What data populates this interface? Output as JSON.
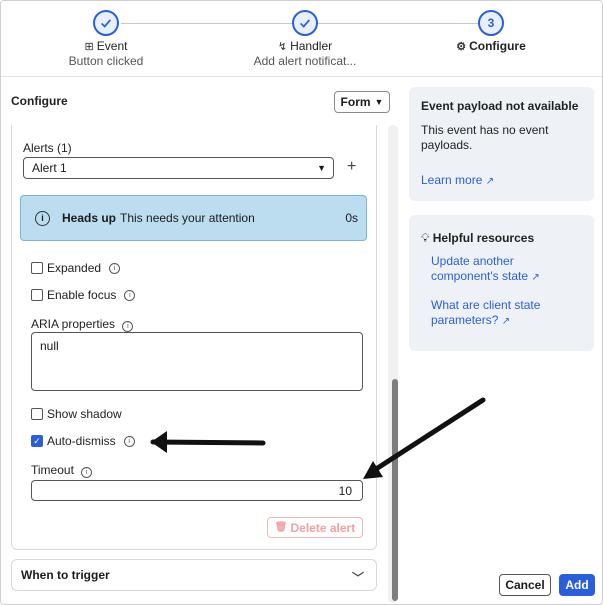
{
  "stepper": {
    "steps": [
      {
        "title": "Event",
        "subtitle": "Button clicked",
        "state": "completed"
      },
      {
        "title": "Handler",
        "subtitle": "Add alert notificat...",
        "state": "completed"
      },
      {
        "title": "Configure",
        "number": "3",
        "state": "current"
      }
    ]
  },
  "left_panel": {
    "title": "Configure",
    "form_button": "Form",
    "alerts_label": "Alerts (1)",
    "alert_select_value": "Alert 1",
    "preview": {
      "heading": "Heads up",
      "message": "This needs your attention",
      "time": "0s"
    },
    "expanded_label": "Expanded",
    "enable_focus_label": "Enable focus",
    "aria_label": "ARIA properties",
    "aria_value": "null",
    "show_shadow_label": "Show shadow",
    "auto_dismiss_label": "Auto-dismiss",
    "auto_dismiss_checked": true,
    "timeout_label": "Timeout",
    "timeout_value": "10",
    "delete_button": "Delete alert",
    "when_to_trigger": "When to trigger"
  },
  "right_panel": {
    "payload_card": {
      "title": "Event payload not available",
      "text": "This event has no event payloads.",
      "link": "Learn more"
    },
    "resources_card": {
      "title": "Helpful resources",
      "links": [
        "Update another component's state",
        "What are client state parameters?"
      ]
    }
  },
  "footer": {
    "cancel": "Cancel",
    "add": "Add"
  },
  "colors": {
    "accent": "#2b5fd9",
    "alert_bg": "#bcdcf0",
    "card_bg": "#eef1f5",
    "danger_light": "#f1a1a1"
  }
}
